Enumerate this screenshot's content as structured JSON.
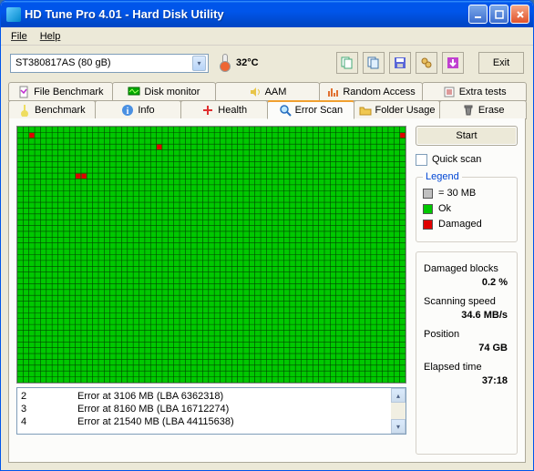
{
  "title": "HD Tune Pro 4.01 - Hard Disk Utility",
  "menu": {
    "file": "File",
    "help": "Help"
  },
  "drive": "ST380817AS (80 gB)",
  "temperature": "32°C",
  "exit": "Exit",
  "tabs_top": {
    "file_benchmark": "File Benchmark",
    "disk_monitor": "Disk monitor",
    "aam": "AAM",
    "random_access": "Random Access",
    "extra_tests": "Extra tests"
  },
  "tabs_bottom": {
    "benchmark": "Benchmark",
    "info": "Info",
    "health": "Health",
    "error_scan": "Error Scan",
    "folder_usage": "Folder Usage",
    "erase": "Erase"
  },
  "start": "Start",
  "quick_scan": "Quick scan",
  "legend": {
    "title": "Legend",
    "size": "= 30 MB",
    "ok": "Ok",
    "damaged": "Damaged"
  },
  "stats": {
    "damaged_label": "Damaged blocks",
    "damaged_val": "0.2 %",
    "speed_label": "Scanning speed",
    "speed_val": "34.6 MB/s",
    "position_label": "Position",
    "position_val": "74 GB",
    "elapsed_label": "Elapsed time",
    "elapsed_val": "37:18"
  },
  "errors": [
    {
      "n": "2",
      "msg": "Error at 3106 MB (LBA 6362318)"
    },
    {
      "n": "3",
      "msg": "Error at 8160 MB (LBA 16712274)"
    },
    {
      "n": "4",
      "msg": "Error at 21540 MB (LBA 44115638)"
    }
  ],
  "damaged_cells": [
    {
      "c": 2,
      "r": 1
    },
    {
      "c": 66,
      "r": 1
    },
    {
      "c": 24,
      "r": 3
    },
    {
      "c": 10,
      "r": 8
    },
    {
      "c": 11,
      "r": 8
    }
  ]
}
